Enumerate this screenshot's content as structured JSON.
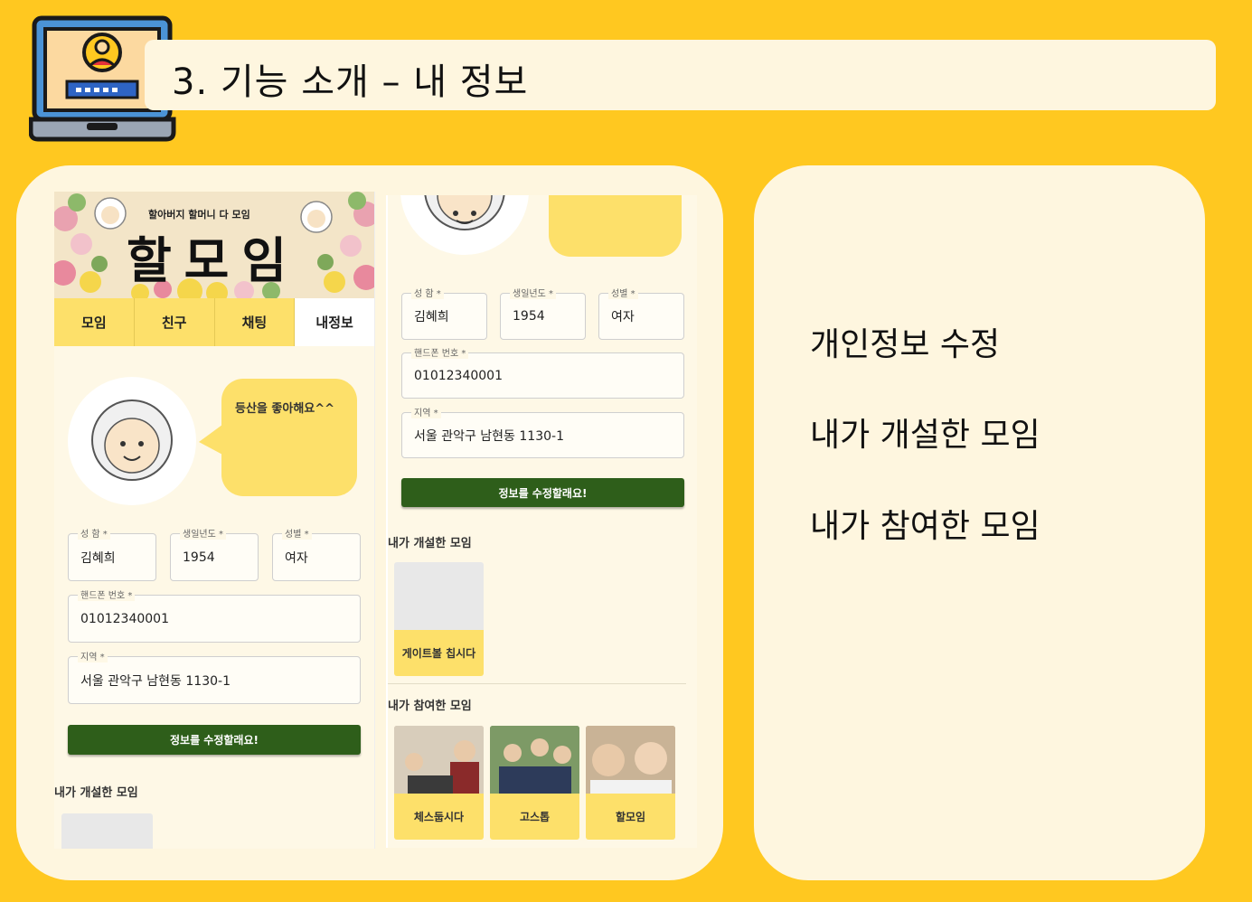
{
  "slide": {
    "title": "3. 기능 소개 – 내 정보",
    "features": [
      "개인정보 수정",
      "내가 개설한 모임",
      "내가 참여한 모임"
    ]
  },
  "app": {
    "banner_subtitle": "할아버지 할머니 다 모임",
    "banner_title": "할모임",
    "tabs": [
      "모임",
      "친구",
      "채팅",
      "내정보"
    ],
    "active_tab": "내정보",
    "status_message": "등산을 좋아해요^^",
    "form": {
      "name_label": "성 함 *",
      "name_value": "김혜희",
      "birth_label": "생일년도 *",
      "birth_value": "1954",
      "gender_label": "성별 *",
      "gender_value": "여자",
      "phone_label": "핸드폰 번호 *",
      "phone_value": "01012340001",
      "region_label": "지역 *",
      "region_value": "서울 관악구 남현동 1130-1"
    },
    "submit_label": "정보를 수정할래요!",
    "created_section": "내가 개설한 모임",
    "joined_section": "내가 참여한 모임",
    "created_groups": [
      "게이트볼 칩시다"
    ],
    "joined_groups": [
      "체스둡시다",
      "고스톱",
      "할모임"
    ]
  },
  "colors": {
    "background": "#FFC820",
    "panel": "#FEF6DF",
    "tab": "#FDE06A",
    "button": "#2E5E1A"
  }
}
